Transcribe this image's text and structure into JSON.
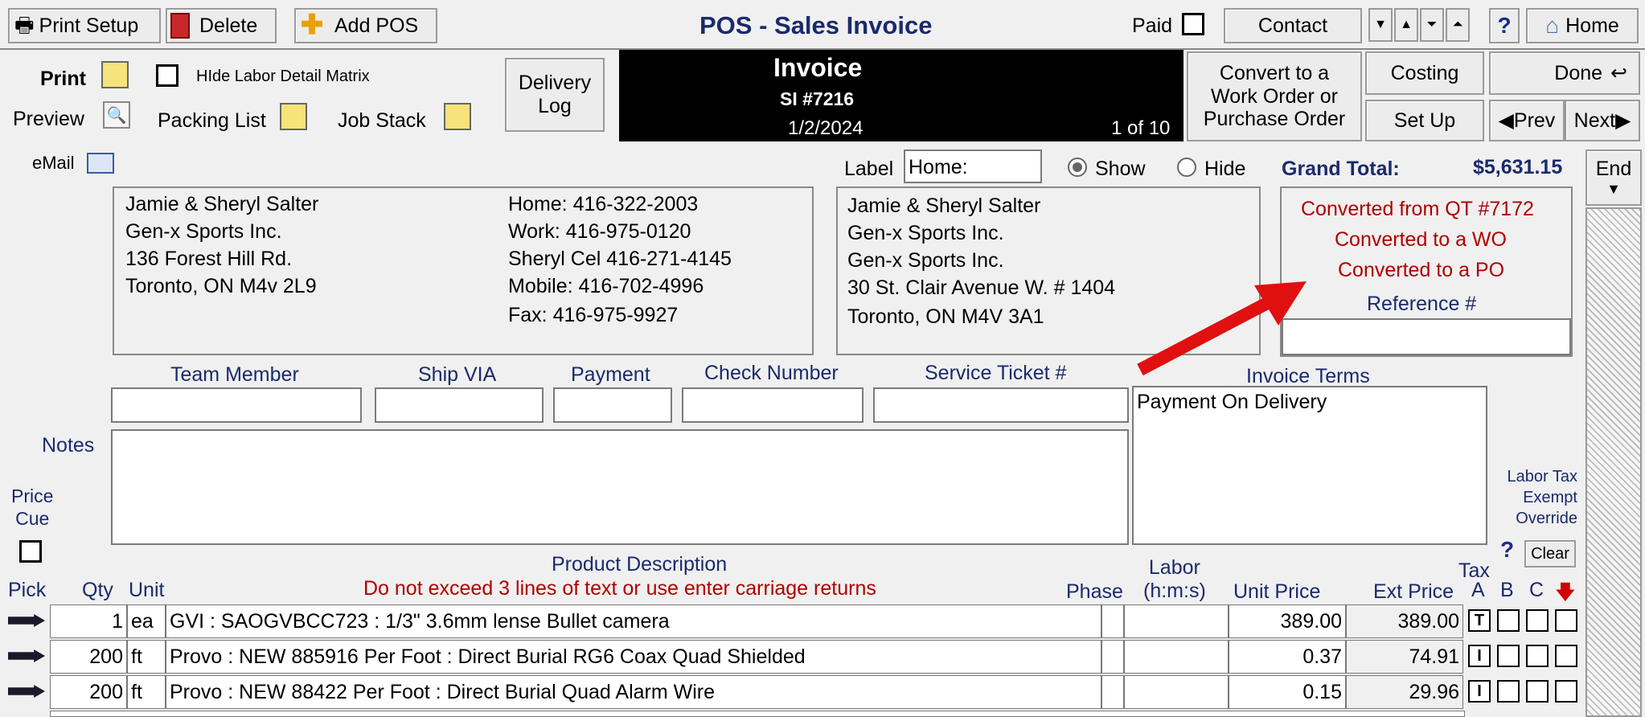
{
  "toolbar": {
    "print_setup": "Print Setup",
    "delete": "Delete",
    "add_pos": "Add POS",
    "title": "POS - Sales Invoice",
    "paid": "Paid",
    "contact": "Contact",
    "help": "?",
    "home": "Home"
  },
  "row2": {
    "print": "Print",
    "preview": "Preview",
    "hide_labor": "HIde Labor Detail Matrix",
    "packing_list": "Packing List",
    "job_stack": "Job Stack",
    "delivery_log": "Delivery\nLog",
    "convert": "Convert to a\nWork Order or\nPurchase Order",
    "costing": "Costing",
    "setup": "Set Up",
    "done": "Done",
    "prev": "Prev",
    "next": "Next"
  },
  "invoice": {
    "heading": "Invoice",
    "number": "SI #7216",
    "date": "1/2/2024",
    "page": "1 of 10"
  },
  "email": "eMail",
  "label": {
    "text": "Label",
    "value": "Home:",
    "show": "Show",
    "hide": "Hide"
  },
  "grand_total": {
    "label": "Grand Total:",
    "value": "$5,631.15"
  },
  "end": "End",
  "bill_to": {
    "lines": [
      "Jamie & Sheryl Salter",
      "Gen-x Sports Inc.",
      "136 Forest Hill Rd.",
      "Toronto, ON M4v 2L9"
    ],
    "phones": [
      "Home: 416-322-2003",
      "Work: 416-975-0120",
      "Sheryl Cel 416-271-4145",
      "Mobile: 416-702-4996",
      "Fax: 416-975-9927"
    ]
  },
  "ship_to": {
    "lines": [
      "Jamie & Sheryl Salter",
      "Gen-x Sports Inc.",
      "Gen-x Sports Inc.",
      "30 St. Clair Avenue W. # 1404",
      "Toronto, ON M4V 3A1"
    ]
  },
  "conversion": {
    "lines": [
      "Converted from QT #7172",
      "Converted to a WO",
      "Converted to a PO"
    ],
    "reference": "Reference #"
  },
  "fields": {
    "team_member": "Team Member",
    "ship_via": "Ship VIA",
    "payment": "Payment",
    "check_number": "Check Number",
    "service_ticket": "Service Ticket #",
    "invoice_terms": "Invoice Terms",
    "terms_value": "Payment On Delivery"
  },
  "notes": "Notes",
  "price_cue": "Price\nCue",
  "labor_tax": "Labor Tax\nExempt\nOverride",
  "clear": "Clear",
  "columns": {
    "pick": "Pick",
    "qty": "Qty",
    "unit": "Unit",
    "desc": "Product Description",
    "desc_warning": "Do not exceed 3 lines of text or use enter carriage returns",
    "phase": "Phase",
    "labor": "Labor\n(h:m:s)",
    "unit_price": "Unit Price",
    "ext_price": "Ext Price",
    "tax": "Tax",
    "a": "A",
    "b": "B",
    "c": "C"
  },
  "lines": [
    {
      "qty": "1",
      "unit": "ea",
      "desc": "GVI : SAOGVBCC723 : 1/3\" 3.6mm lense  Bullet camera",
      "unit_price": "389.00",
      "ext_price": "389.00",
      "tax": "T"
    },
    {
      "qty": "200",
      "unit": "ft",
      "desc": "Provo : NEW 885916 Per Foot : Direct Burial RG6 Coax Quad Shielded",
      "unit_price": "0.37",
      "ext_price": "74.91",
      "tax": "I"
    },
    {
      "qty": "200",
      "unit": "ft",
      "desc": "Provo : NEW 88422 Per Foot : Direct Burial Quad Alarm Wire",
      "unit_price": "0.15",
      "ext_price": "29.96",
      "tax": "I"
    }
  ]
}
